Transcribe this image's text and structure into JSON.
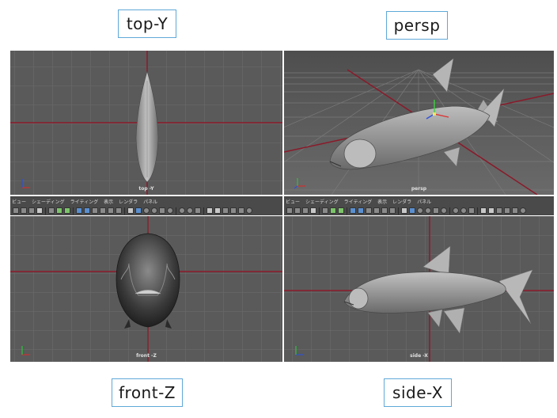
{
  "captions": {
    "top": "top-Y",
    "persp": "persp",
    "front": "front-Z",
    "side": "side-X"
  },
  "viewports": {
    "top": {
      "label": "top -Y"
    },
    "persp": {
      "label": "persp"
    },
    "front": {
      "label": "front -Z"
    },
    "side": {
      "label": "side -X"
    }
  },
  "panel_menu": [
    "ビュー",
    "シェーディング",
    "ライティング",
    "表示",
    "レンダラ",
    "パネル"
  ],
  "colors": {
    "viewport_bg": "#5a5a5a",
    "grid": "#6d6d6d",
    "axis_red": "#8b1a2a",
    "fish_fill": "#9a9a9a",
    "fish_fin": "#b8b8b8",
    "caption_border": "#5fa8d8"
  },
  "axis_gizmo": {
    "x": "x",
    "y": "y",
    "z": "z"
  }
}
